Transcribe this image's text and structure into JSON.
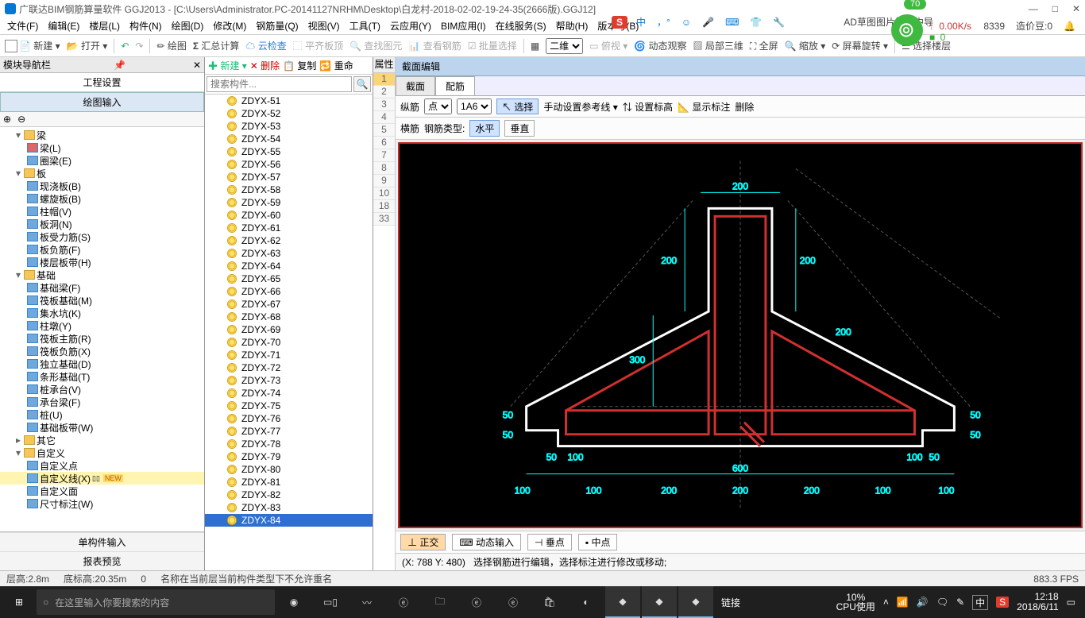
{
  "title": "广联达BIM钢筋算量软件 GGJ2013 - [C:\\Users\\Administrator.PC-20141127NRHM\\Desktop\\白龙村-2018-02-02-19-24-35(2666版).GGJ12]",
  "badge70": "70",
  "menu": [
    "文件(F)",
    "编辑(E)",
    "楼层(L)",
    "构件(N)",
    "绘图(D)",
    "修改(M)",
    "钢筋量(Q)",
    "视图(V)",
    "工具(T)",
    "云应用(Y)",
    "BIM应用(I)",
    "在线服务(S)",
    "帮助(H)",
    "版本号(B)"
  ],
  "overlay_label": "AD草图图片管理中导",
  "title_extra": {
    "num": "8339",
    "beans": "造价豆:0"
  },
  "speed": {
    "up": "0.00K/s",
    "down": "0"
  },
  "toolbar": {
    "new": "新建",
    "open": "打开",
    "draw": "绘图",
    "sum": "汇总计算",
    "cloud": "云检查",
    "flat": "平齐板顶",
    "find": "查找图元",
    "view_steel": "查看钢筋",
    "batch": "批量选择",
    "dim_sel": "二维",
    "pan": "俯视",
    "dyn": "动态观察",
    "local3d": "局部三维",
    "full": "全屏",
    "zoom": "缩放",
    "rot": "屏幕旋转",
    "sel_floor": "选择楼层"
  },
  "nav": {
    "header": "模块导航栏",
    "proj": "工程设置",
    "draw": "绘图输入",
    "single": "单构件输入",
    "report": "报表预览"
  },
  "tree": {
    "liang": "梁",
    "liang_l": "梁(L)",
    "quan_liang": "圈梁(E)",
    "ban": "板",
    "xjb": "现浇板(B)",
    "lxb": "螺旋板(B)",
    "zhumao": "柱帽(V)",
    "bandong": "板洞(N)",
    "bslj": "板受力筋(S)",
    "bfj": "板负筋(F)",
    "lcbd": "楼层板带(H)",
    "jichu": "基础",
    "jcl": "基础梁(F)",
    "fbjc": "筏板基础(M)",
    "jsk": "集水坑(K)",
    "zhudun": "柱墩(Y)",
    "fbzj": "筏板主筋(R)",
    "fbfj": "筏板负筋(X)",
    "dljc": "独立基础(D)",
    "txjc": "条形基础(T)",
    "zct": "桩承台(V)",
    "ctl": "承台梁(F)",
    "zhuang": "桩(U)",
    "jcbd": "基础板带(W)",
    "qita": "其它",
    "zdy": "自定义",
    "zdyd": "自定义点",
    "zdyx": "自定义线(X)",
    "zdym": "自定义面",
    "ccbz": "尺寸标注(W)",
    "new": "NEW"
  },
  "mid": {
    "new": "新建",
    "del": "删除",
    "copy": "复制",
    "rename": "重命",
    "ph": "搜索构件...",
    "prop_tab": "属性",
    "items_prefix": "ZDYX-",
    "sel": "ZDYX-84"
  },
  "editor": {
    "title": "截面编辑",
    "tab1": "截面",
    "tab2": "配筋",
    "row1": {
      "zongjin": "纵筋",
      "dian": "点",
      "spec": "1A6",
      "select": "选择",
      "manual": "手动设置参考线",
      "setbz": "设置标高",
      "showbz": "显示标注",
      "del": "删除"
    },
    "row2": {
      "hengjin": "横筋",
      "type": "钢筋类型:",
      "shuiping": "水平",
      "chuizhi": "垂直"
    },
    "bot": {
      "zj": "正交",
      "dt": "动态输入",
      "cd": "垂点",
      "zd": "中点"
    },
    "status": {
      "coord": "(X: 788 Y: 480)",
      "hint": "选择钢筋进行编辑，选择标注进行修改或移动;"
    }
  },
  "chart_data": {
    "type": "schematic-section",
    "dims": {
      "top_w": 200,
      "top_h": 200,
      "mid_h": 300,
      "bot_h1": 50,
      "bot_h2": 50,
      "overall_w": 600,
      "wing": 100,
      "gap": 100,
      "seg": 200,
      "side": 50
    }
  },
  "footer": {
    "floor_h": "层高:2.8m",
    "bot_h": "底标高:20.35m",
    "zero": "0",
    "msg": "名称在当前层当前构件类型下不允许重名",
    "fps": "883.3 FPS"
  },
  "taskbar": {
    "search": "在这里输入你要搜索的内容",
    "link": "链接",
    "cpu": "10%",
    "cpu_lbl": "CPU使用",
    "ime": "中",
    "time": "12:18",
    "date": "2018/6/11"
  },
  "win_btns": {
    "min": "—",
    "max": "□",
    "close": "✕"
  },
  "overlay_s": "S",
  "overlay_zhong": "中"
}
